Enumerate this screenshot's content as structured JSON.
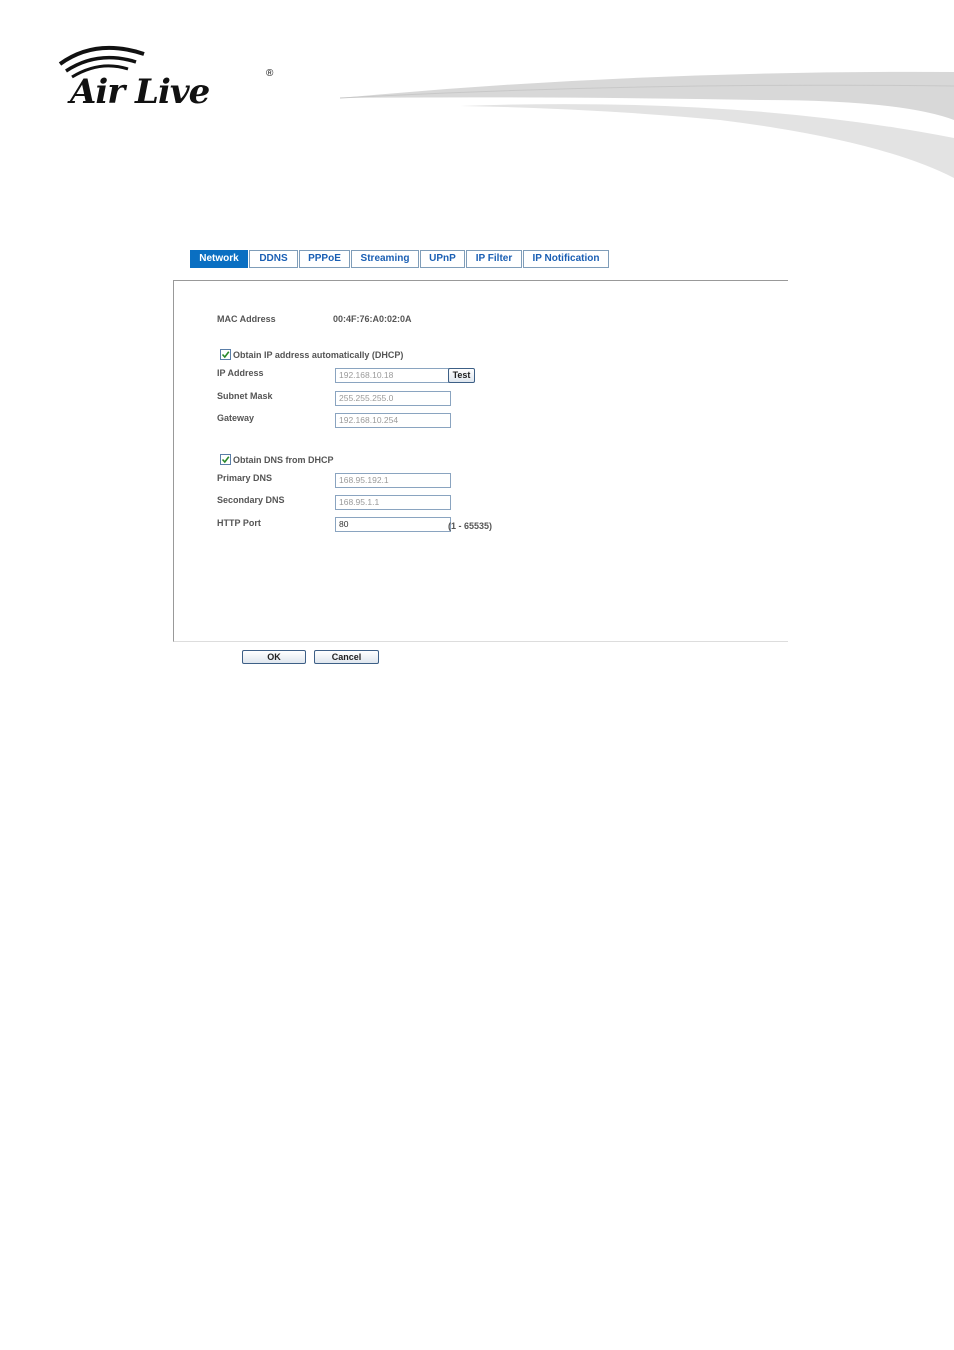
{
  "brand": {
    "name": "Air Live",
    "registered": "®"
  },
  "tabs": [
    {
      "label": "Network",
      "active": true
    },
    {
      "label": "DDNS"
    },
    {
      "label": "PPPoE"
    },
    {
      "label": "Streaming"
    },
    {
      "label": "UPnP"
    },
    {
      "label": "IP Filter"
    },
    {
      "label": "IP Notification"
    }
  ],
  "form": {
    "mac_label": "MAC Address",
    "mac_value": "00:4F:76:A0:02:0A",
    "dhcp_ip_label": "Obtain IP address automatically (DHCP)",
    "dhcp_ip_checked": true,
    "ip_label": "IP Address",
    "ip_value": "192.168.10.18",
    "test_label": "Test",
    "subnet_label": "Subnet Mask",
    "subnet_value": "255.255.255.0",
    "gateway_label": "Gateway",
    "gateway_value": "192.168.10.254",
    "dhcp_dns_label": "Obtain DNS from DHCP",
    "dhcp_dns_checked": true,
    "primary_dns_label": "Primary DNS",
    "primary_dns_value": "168.95.192.1",
    "secondary_dns_label": "Secondary DNS",
    "secondary_dns_value": "168.95.1.1",
    "http_port_label": "HTTP Port",
    "http_port_value": "80",
    "http_port_range": "(1 - 65535)"
  },
  "actions": {
    "ok_label": "OK",
    "cancel_label": "Cancel"
  },
  "colors": {
    "tab_active": "#0a6fc2",
    "tab_text": "#1a5fb4",
    "field_border": "#8aa4c0"
  }
}
